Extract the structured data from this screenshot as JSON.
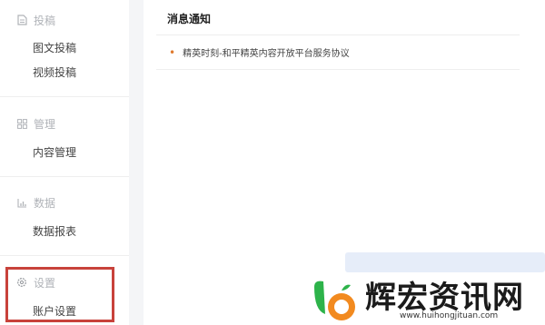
{
  "sidebar": {
    "groups": [
      {
        "title": "投稿",
        "icon": "document-icon",
        "items": [
          "图文投稿",
          "视频投稿"
        ]
      },
      {
        "title": "管理",
        "icon": "grid-icon",
        "items": [
          "内容管理"
        ]
      },
      {
        "title": "数据",
        "icon": "bar-chart-icon",
        "items": [
          "数据报表"
        ]
      },
      {
        "title": "设置",
        "icon": "gear-icon",
        "items": [
          "账户设置"
        ]
      }
    ]
  },
  "main": {
    "title": "消息通知",
    "notices": [
      "精英时刻-和平精英内容开放平台服务协议"
    ]
  },
  "watermark": {
    "title": "辉宏资讯网",
    "url": "www.huihongjituan.com"
  },
  "colors": {
    "highlight": "#c8423b",
    "notice_dot": "#e07a2e"
  }
}
